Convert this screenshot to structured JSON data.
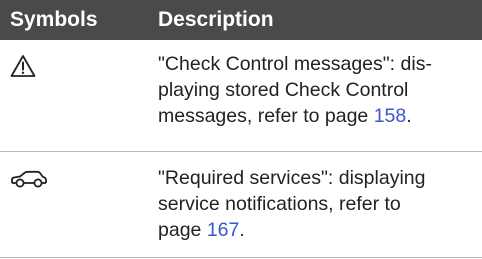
{
  "header": {
    "symbols_label": "Symbols",
    "description_label": "Description"
  },
  "rows": [
    {
      "icon": "warning-triangle-icon",
      "description_text": "\"Check Control messages\": dis-playing stored Check Control messages, refer to page ",
      "page_link": "158",
      "trailing": "."
    },
    {
      "icon": "car-service-icon",
      "description_text": "\"Required services\": displaying service notifications, refer to page ",
      "page_link": "167",
      "trailing": "."
    }
  ],
  "colors": {
    "header_background": "#4a4a4a",
    "header_text": "#ffffff",
    "link": "#3a55d4",
    "divider": "#b8b8b8"
  }
}
